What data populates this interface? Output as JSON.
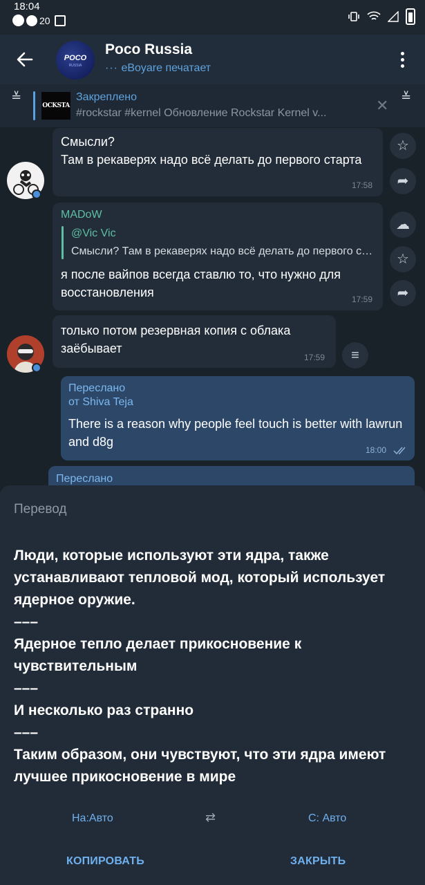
{
  "status_bar": {
    "time": "18:04",
    "notification_count": "20"
  },
  "header": {
    "chat_title": "Poco Russia",
    "avatar_text": "POCO",
    "avatar_subtext": "RUSSIA",
    "typing": "eBoyare печатает"
  },
  "pinned": {
    "label": "Закреплено",
    "thumb_text": "OCKSTA",
    "text": "#rockstar #kernel Обновление Rockstar Kernel v..."
  },
  "messages": [
    {
      "text": "Смысли?\nТам в рекаверях надо всё делать до первого старта",
      "time": "17:58"
    },
    {
      "sender": "MADoW",
      "reply_name": "@Vic Vic",
      "reply_text": "Смысли? Там в рекаверях надо всё делать до первого старта",
      "text": "я после вайпов всегда ставлю то, что нужно для восстановления",
      "time": "17:59"
    },
    {
      "text": "только потом резервная копия с облака заёбывает",
      "time": "17:59"
    },
    {
      "forward_label": "Переслано",
      "forward_from": "от Shiva Teja",
      "text": "There is a reason why people feel touch is better with lawrun and d8g",
      "time": "18:00"
    },
    {
      "forward_label": "Переслано"
    }
  ],
  "translation": {
    "title": "Перевод",
    "text": "Люди, которые используют эти ядра, также устанавливают тепловой мод, который использует ядерное оружие.\n–––\nЯдерное тепло делает прикосновение к чувствительным\n–––\nИ несколько раз странно\n–––\nТаким образом, они чувствуют, что эти ядра имеют лучшее прикосновение в мире",
    "to_lang": "На:Авто",
    "from_lang": "С: Авто",
    "copy_label": "КОПИРОВАТЬ",
    "close_label": "ЗАКРЫТЬ"
  }
}
